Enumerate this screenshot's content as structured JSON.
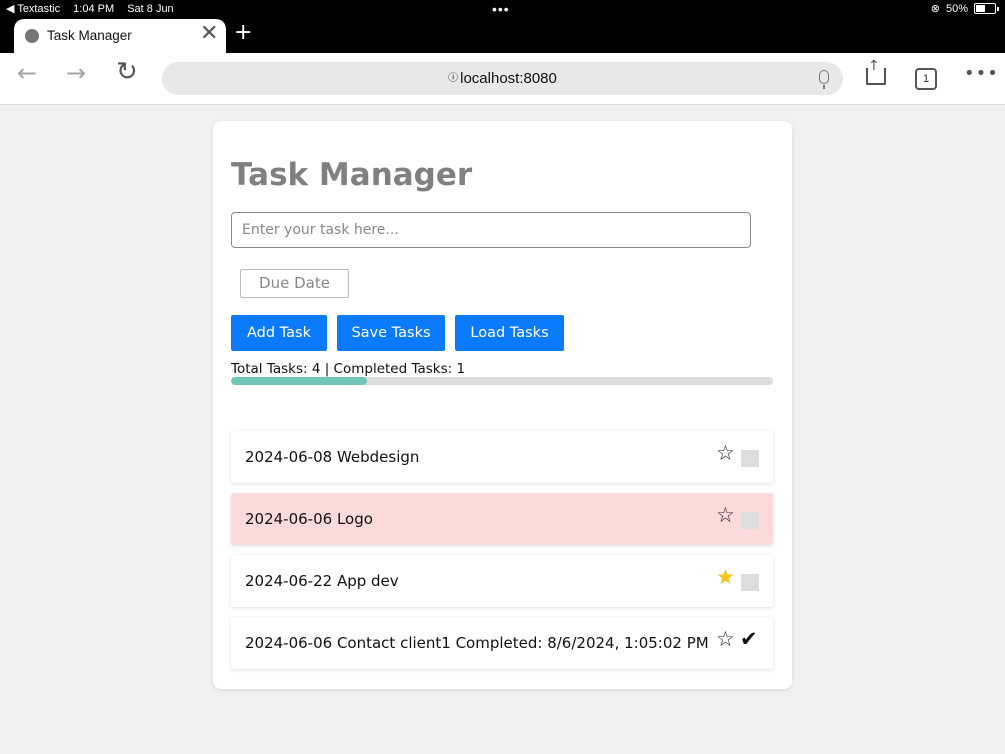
{
  "status_bar": {
    "back_app": "◀ Textastic",
    "time": "1:04 PM",
    "date": "Sat 8 Jun",
    "battery": "50%"
  },
  "browser": {
    "tab_title": "Task Manager",
    "url": "localhost:8080",
    "tab_count": "1"
  },
  "app": {
    "title": "Task Manager",
    "input_placeholder": "Enter your task here...",
    "due_date_label": "Due Date",
    "buttons": {
      "add": "Add Task",
      "save": "Save Tasks",
      "load": "Load Tasks"
    },
    "stats": "Total Tasks: 4 | Completed Tasks: 1",
    "progress": 0.25,
    "accent_color": "#0a7bff",
    "progress_color": "#72c6b7",
    "overdue_color": "#fddada",
    "tasks": [
      {
        "text": "2024-06-08 Webdesign",
        "starred": false,
        "completed": false,
        "overdue": false
      },
      {
        "text": "2024-06-06 Logo",
        "starred": false,
        "completed": false,
        "overdue": true
      },
      {
        "text": "2024-06-22 App dev",
        "starred": true,
        "completed": false,
        "overdue": false
      },
      {
        "text": "2024-06-06 Contact client1 Completed: 8/6/2024, 1:05:02 PM",
        "starred": false,
        "completed": true,
        "overdue": false
      }
    ]
  }
}
